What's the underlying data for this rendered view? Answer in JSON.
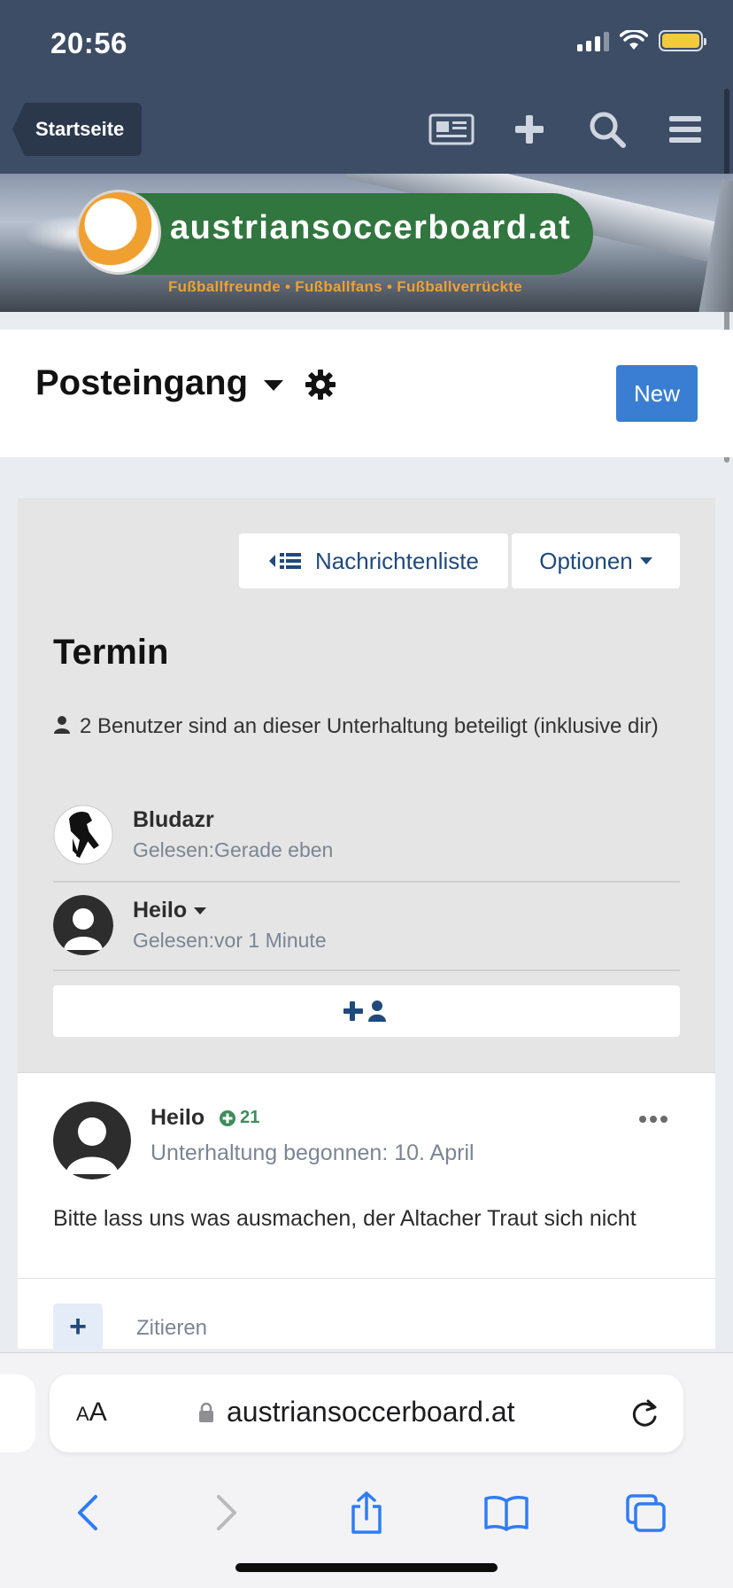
{
  "status_bar": {
    "time": "20:56"
  },
  "nav": {
    "home_label": "Startseite",
    "icons": [
      "newspaper-icon",
      "plus-icon",
      "search-icon",
      "menu-icon"
    ]
  },
  "banner": {
    "brand": "austriansoccerboard.at",
    "tagline": "Fußballfreunde • Fußballfans • Fußballverrückte"
  },
  "page": {
    "title": "Posteingang",
    "new_button": "New"
  },
  "conversation": {
    "message_list_button": "Nachrichtenliste",
    "options_button": "Optionen",
    "title": "Termin",
    "participants_text": "2 Benutzer sind an dieser Unterhaltung beteiligt (inklusive dir)",
    "participants": [
      {
        "name": "Bludazr",
        "read": "Gelesen:Gerade eben"
      },
      {
        "name": "Heilo",
        "read": "Gelesen:vor 1 Minute"
      }
    ]
  },
  "message": {
    "author": "Heilo",
    "reputation": "21",
    "meta": "Unterhaltung begonnen: 10. April",
    "text": "Bitte lass uns was ausmachen, der Altacher Traut sich nicht",
    "quote_label": "Zitieren"
  },
  "browser": {
    "text_size_label_small": "A",
    "text_size_label_large": "A",
    "url": "austriansoccerboard.at"
  },
  "colors": {
    "header_bg": "#3d4d66",
    "accent": "#3a7ed3",
    "reputation": "#3f8c5c"
  }
}
